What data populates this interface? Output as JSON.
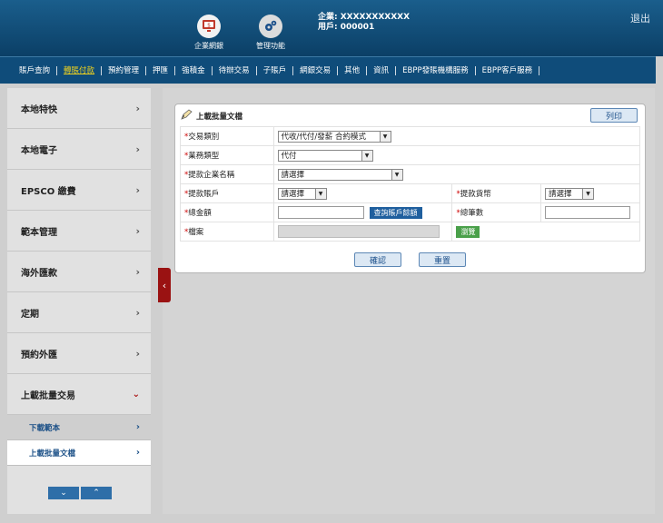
{
  "header": {
    "btn_corporate": "企業網銀",
    "btn_manage": "管理功能",
    "company_line": "企業: XXXXXXXXXXX",
    "user_line": "用戶: 000001",
    "logout": "退出"
  },
  "nav": {
    "items": [
      "賬戶查詢",
      "轉賬付款",
      "預約管理",
      "押匯",
      "強積金",
      "待辦交易",
      "子賬戶",
      "網銀交易",
      "其他",
      "資訊",
      "EBPP發賬機構服務",
      "EBPP客戶服務"
    ],
    "active_index": 1
  },
  "sidebar": {
    "items": [
      "本地特快",
      "本地電子",
      "EPSCO 繳費",
      "範本管理",
      "海外匯款",
      "定期",
      "預約外匯",
      "上載批量交易"
    ],
    "sub_items": [
      "下載範本",
      "上載批量文檔"
    ],
    "scroll_down": "⌄",
    "scroll_up": "⌃"
  },
  "panel": {
    "title": "上載批量文檔",
    "print": "列印",
    "fields": {
      "txn_type_label": "交易類別",
      "txn_type_value": "代收/代付/發薪 合約模式",
      "biz_type_label": "業務類型",
      "biz_type_value": "代付",
      "company_label": "提款企業名稱",
      "company_value": "請選擇",
      "account_label": "提款賬戶",
      "account_value": "請選擇",
      "currency_label": "提款貨幣",
      "currency_value": "請選擇",
      "amount_label": "總金額",
      "balance_btn": "查詢賬戶餘額",
      "count_label": "總筆數",
      "file_label": "檔案",
      "browse_btn": "瀏覽"
    },
    "confirm": "確認",
    "reset": "重置"
  }
}
